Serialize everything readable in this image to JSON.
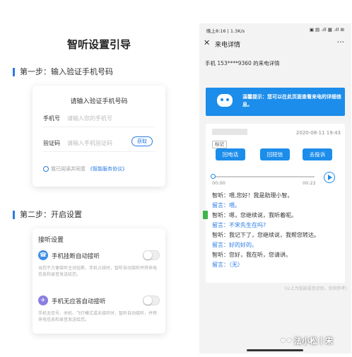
{
  "left": {
    "title": "智听设置引导",
    "step1": "第一步：输入验证手机号码",
    "card1": {
      "title": "请输入验证手机号码",
      "phone_label": "手机号",
      "phone_placeholder": "请输入您的手机号",
      "code_label": "验证码",
      "code_placeholder": "请输入手机验证码",
      "get_button": "获取",
      "agree_text": "我已阅读并同意",
      "agree_link": "《智能服务协议》"
    },
    "step2": "第二步：开启设置",
    "card2": {
      "title": "接听设置",
      "opt1_name": "手机挂断自动接听",
      "opt1_desc": "当您不方便接听主动挂断、手机占线时，智听自动接听并将来电信息和录音发送给您。",
      "opt2_name": "手机无应答自动接听",
      "opt2_desc": "手机无信号、关机、飞行模式或未接听时，智听自动接听，并将来电信息和录音发送给您。"
    }
  },
  "phone": {
    "status_left": "晚上8:16 | 1.3K/s",
    "status_right": "▣ ▤ .ıll ▦ .ıll ⊞",
    "nav_title": "来电详情",
    "phone_line": "手机 153****9360 的来电详情",
    "tip": "温馨提示：您可以在此页面查看来电的详细信息。",
    "record": {
      "time": "2020-08-11 19:43",
      "badge": "标记",
      "btn_callback": "回电话",
      "btn_sms": "回短信",
      "btn_complain": "去投诉",
      "t_start": "00:00",
      "t_end": "00:22",
      "messages": [
        {
          "speaker": "智听：",
          "text": "喂,您好！我是助理小智。",
          "type": "zt"
        },
        {
          "speaker": "留言：",
          "text": "喂。",
          "type": "ly"
        },
        {
          "speaker": "智听：",
          "text": "嗯，您继续说，我听着呢。",
          "type": "zt"
        },
        {
          "speaker": "留言：",
          "text": "不宋先生在吗?",
          "type": "ly"
        },
        {
          "speaker": "智听：",
          "text": "我记下了，您继续说，我帮您转达。",
          "type": "zt"
        },
        {
          "speaker": "留言：",
          "text": "好的好的。",
          "type": "ly"
        },
        {
          "speaker": "智听：",
          "text": "您好，我在听，您请讲。",
          "type": "zt"
        },
        {
          "speaker": "留言：",
          "text": "（无）",
          "type": "ly"
        }
      ]
    },
    "note": "(以上为智能语音识别，仅供参考)",
    "watermark": "法小松丨宋"
  },
  "colors": {
    "accent": "#1c8dea",
    "link": "#2a7be4",
    "toggle_icon1": "#3e8ee6",
    "toggle_icon2": "#8a7fe0"
  }
}
